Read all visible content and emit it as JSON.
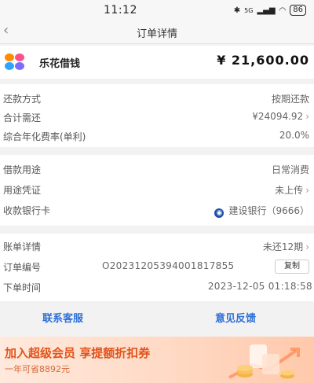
{
  "status": {
    "time": "11:12",
    "network": "5G",
    "battery": "86"
  },
  "nav": {
    "title": "订单详情"
  },
  "header": {
    "brand": "乐花借钱",
    "amount": "¥ 21,600.00"
  },
  "repayment": {
    "method_label": "还款方式",
    "method_value": "按期还款",
    "total_label": "合计需还",
    "total_value": "¥24094.92",
    "rate_label": "综合年化费率(单利)",
    "rate_value": "20.0%"
  },
  "loan": {
    "purpose_label": "借款用途",
    "purpose_value": "日常消费",
    "proof_label": "用途凭证",
    "proof_value": "未上传",
    "card_label": "收款银行卡",
    "card_value": "建设银行（9666）"
  },
  "order": {
    "bill_label": "账单详情",
    "bill_value": "未还12期",
    "number_label": "订单编号",
    "number_value": "O20231205394001817855",
    "copy_label": "复制",
    "time_label": "下单时间",
    "time_value": "2023-12-05 01:18:58"
  },
  "footer": {
    "contact": "联系客服",
    "feedback": "意见反馈"
  },
  "banner": {
    "title": "加入超级会员 享提额折扣券",
    "subtitle": "一年可省8892元"
  },
  "colors": {
    "accent": "#2d6fd6",
    "banner_text": "#e2541b"
  }
}
